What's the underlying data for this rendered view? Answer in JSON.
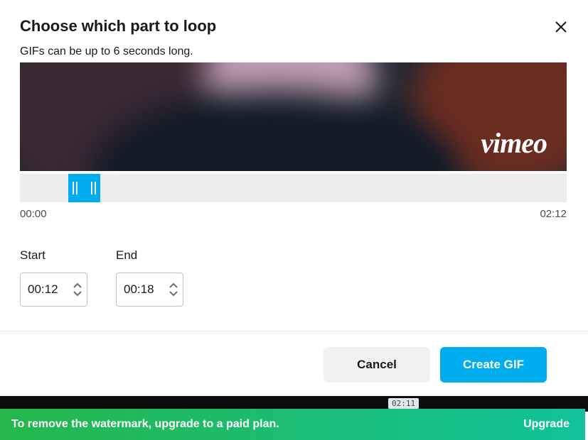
{
  "dialog": {
    "title": "Choose which part to loop",
    "subtitle": "GIFs can be up to 6 seconds long.",
    "watermark": "vimeo"
  },
  "timeline": {
    "start_label": "00:00",
    "end_label": "02:12"
  },
  "fields": {
    "start": {
      "label": "Start",
      "value": "00:12"
    },
    "end": {
      "label": "End",
      "value": "00:18"
    }
  },
  "actions": {
    "cancel": "Cancel",
    "create": "Create GIF"
  },
  "background_timestamp": "02:11",
  "banner": {
    "message": "To remove the watermark, upgrade to a paid plan.",
    "cta": "Upgrade"
  }
}
